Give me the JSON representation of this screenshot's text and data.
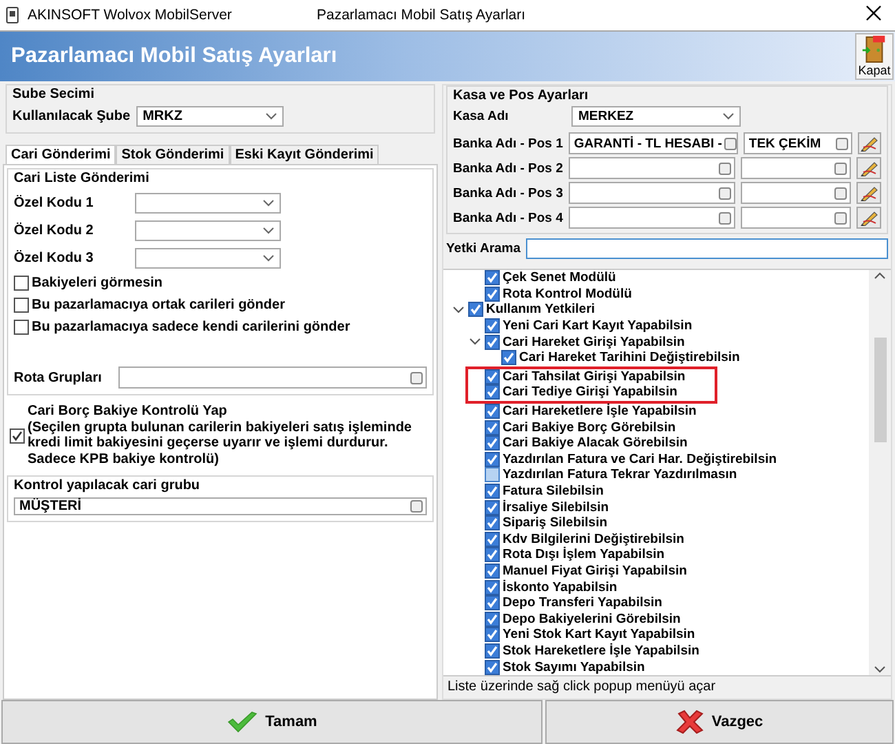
{
  "window": {
    "title": "AKINSOFT Wolvox MobilServer",
    "caption": "Pazarlamacı Mobil Satış Ayarları"
  },
  "header": {
    "title": "Pazarlamacı Mobil Satış Ayarları",
    "close_label": "Kapat"
  },
  "branch": {
    "group": "Sube Secimi",
    "label": "Kullanılacak Şube",
    "value": "MRKZ"
  },
  "tabs": [
    {
      "label": "Cari Gönderimi",
      "selected": true
    },
    {
      "label": "Stok Gönderimi",
      "selected": false
    },
    {
      "label": "Eski Kayıt Gönderimi",
      "selected": false
    }
  ],
  "customer_list": {
    "group": "Cari Liste Gönderimi",
    "combos": [
      {
        "label": "Özel Kodu 1"
      },
      {
        "label": "Özel Kodu 2"
      },
      {
        "label": "Özel Kodu 3"
      }
    ],
    "checkboxes": [
      {
        "label": "Bakiyeleri görmesin",
        "checked": false
      },
      {
        "label": "Bu pazarlamacıya ortak carileri gönder",
        "checked": false
      },
      {
        "label": "Bu pazarlamacıya sadece kendi carilerini gönder",
        "checked": false
      }
    ],
    "route_label": "Rota Grupları"
  },
  "balance_check": {
    "checked": true,
    "title": "Cari Borç Bakiye Kontrolü Yap",
    "note": "(Seçilen grupta bulunan carilerin bakiyeleri satış işleminde kredi limit bakiyesini geçerse uyarır ve işlemi durdurur. Sadece KPB bakiye kontrolü)"
  },
  "control_group": {
    "group": "Kontrol yapılacak cari grubu",
    "value": "MÜŞTERİ"
  },
  "pos": {
    "group": "Kasa ve Pos Ayarları",
    "cash_label": "Kasa Adı",
    "cash_value": "MERKEZ",
    "rows": [
      {
        "label": "Banka Adı - Pos 1",
        "bank": "GARANTİ - TL HESABI -",
        "installment": "TEK ÇEKİM"
      },
      {
        "label": "Banka Adı - Pos 2"
      },
      {
        "label": "Banka Adı - Pos 3"
      },
      {
        "label": "Banka Adı - Pos 4"
      }
    ]
  },
  "search": {
    "label": "Yetki Arama"
  },
  "tree": [
    {
      "children": [
        {
          "label": "Çek Senet Modülü",
          "checked": true
        },
        {
          "label": "Rota Kontrol Modülü",
          "checked": true
        }
      ]
    },
    {
      "label": "Kullanım Yetkileri",
      "checked": true,
      "expanded": true,
      "children": [
        {
          "label": "Yeni Cari Kart Kayıt Yapabilsin",
          "checked": true
        },
        {
          "label": "Cari Hareket Girişi Yapabilsin",
          "checked": true,
          "expanded": true,
          "children": [
            {
              "label": "Cari Hareket Tarihini Değiştirebilsin",
              "checked": true
            }
          ]
        },
        {
          "label": "Cari Tahsilat Girişi Yapabilsin",
          "checked": true,
          "highlight": true
        },
        {
          "label": "Cari Tediye Girişi Yapabilsin",
          "checked": true,
          "highlight": true
        },
        {
          "label": "Cari Hareketlere İşle Yapabilsin",
          "checked": true
        },
        {
          "label": "Cari Bakiye Borç Görebilsin",
          "checked": true
        },
        {
          "label": "Cari Bakiye Alacak Görebilsin",
          "checked": true
        },
        {
          "label": "Yazdırılan Fatura ve Cari Har. Değiştirebilsin",
          "checked": true
        },
        {
          "label": "Yazdırılan Fatura Tekrar Yazdırılmasın",
          "checked": false
        },
        {
          "label": "Fatura Silebilsin",
          "checked": true
        },
        {
          "label": "İrsaliye Silebilsin",
          "checked": true
        },
        {
          "label": "Sipariş Silebilsin",
          "checked": true
        },
        {
          "label": "Kdv Bilgilerini Değiştirebilsin",
          "checked": true
        },
        {
          "label": "Rota Dışı İşlem Yapabilsin",
          "checked": true
        },
        {
          "label": "Manuel Fiyat Girişi Yapabilsin",
          "checked": true
        },
        {
          "label": "İskonto Yapabilsin",
          "checked": true
        },
        {
          "label": "Depo Transferi Yapabilsin",
          "checked": true
        },
        {
          "label": "Depo Bakiyelerini Görebilsin",
          "checked": true
        },
        {
          "label": "Yeni Stok Kart Kayıt Yapabilsin",
          "checked": true
        },
        {
          "label": "Stok Hareketlere İşle Yapabilsin",
          "checked": true
        },
        {
          "label": "Stok Sayımı Yapabilsin",
          "checked": true
        }
      ]
    }
  ],
  "status": "Liste üzerinde sağ click popup menüyü açar",
  "buttons": [
    {
      "label": "Tamam",
      "kind": "ok"
    },
    {
      "label": "Vazgec",
      "kind": "cancel"
    }
  ]
}
